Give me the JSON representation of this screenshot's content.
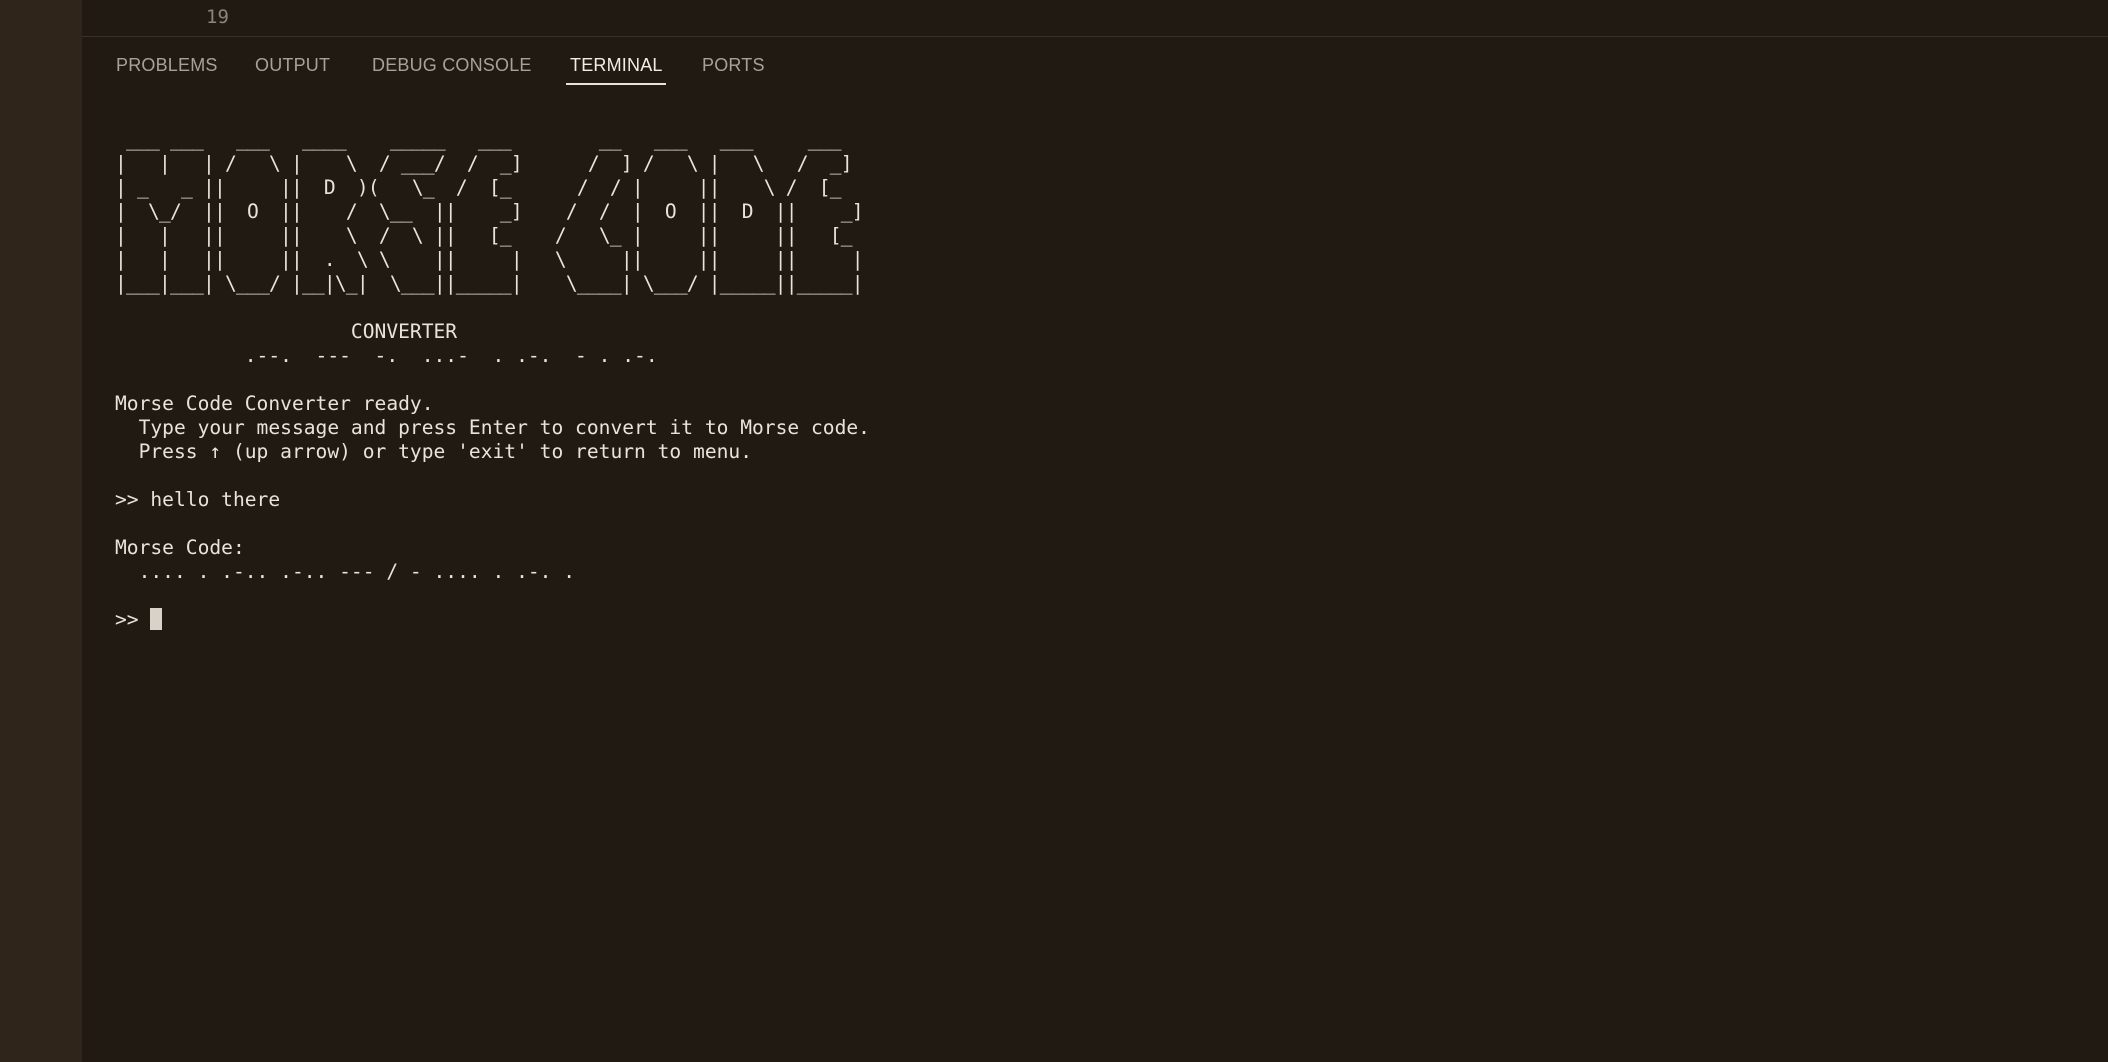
{
  "editor": {
    "line_number": "19"
  },
  "panel": {
    "tabs": [
      {
        "label": "PROBLEMS",
        "active": false
      },
      {
        "label": "OUTPUT",
        "active": false
      },
      {
        "label": "DEBUG CONSOLE",
        "active": false
      },
      {
        "label": "TERMINAL",
        "active": true
      },
      {
        "label": "PORTS",
        "active": false
      }
    ]
  },
  "terminal": {
    "banner_art": " ___ ___   ___   ____    _____   ___        __   ___   ___     ___ \n|   |   | /   \\ |    \\  / ___/  /  _]      /  ] /   \\ |   \\   /  _]\n| _   _ ||     ||  D  )(   \\_  /  [_      /  / |     ||    \\ /  [_ \n|  \\_/  ||  O  ||    /  \\__  ||    _]    /  /  |  O  ||  D  ||    _]\n|   |   ||     ||    \\  /  \\ ||   [_    /   \\_ |     ||     ||   [_ \n|   |   ||     ||  .  \\ \\    ||     |   \\     ||     ||     ||     |\n|___|___| \\___/ |__|\\_|  \\___||_____|    \\____| \\___/ |_____||_____|",
    "subtitle": "                    CONVERTER",
    "subtitle_morse": "           .--.  ---  -.  ...-  . .-.  - . .-.",
    "ready_line": "Morse Code Converter ready.",
    "instruction_line_1": "  Type your message and press Enter to convert it to Morse code.",
    "instruction_line_2": "  Press ↑ (up arrow) or type 'exit' to return to menu.",
    "input_line": ">> hello there",
    "output_label": "Morse Code:",
    "output_value": "  .... . .-.. .-.. --- / - .... . .-. .",
    "prompt": ">> "
  }
}
